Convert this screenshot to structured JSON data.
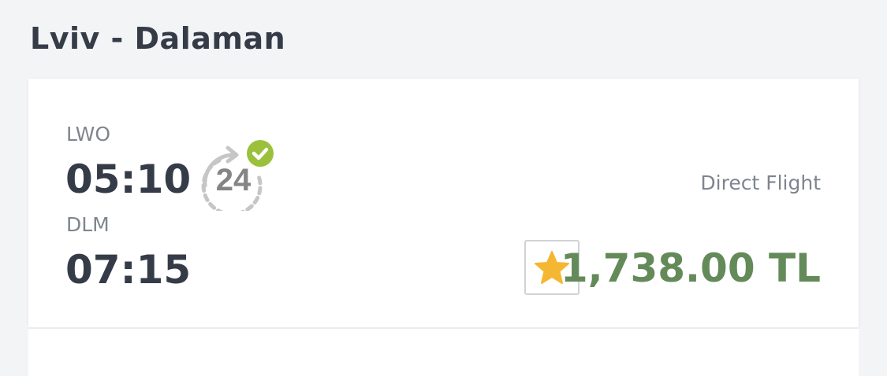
{
  "route": {
    "title": "Lviv - Dalaman"
  },
  "flight": {
    "departure": {
      "code": "LWO",
      "time": "05:10"
    },
    "arrival": {
      "code": "DLM",
      "time": "07:15"
    },
    "badge_number": "24",
    "type_label": "Direct Flight",
    "price": "1,738.00 TL"
  },
  "colors": {
    "price": "#648a5a",
    "check_badge": "#9bc13c",
    "star": "#f5b731",
    "text_dark": "#353c48",
    "text_muted": "#7f858f"
  },
  "icons": {
    "badge": "clock-24-hours-icon",
    "badge_check": "check-icon",
    "favorite": "star-icon"
  }
}
